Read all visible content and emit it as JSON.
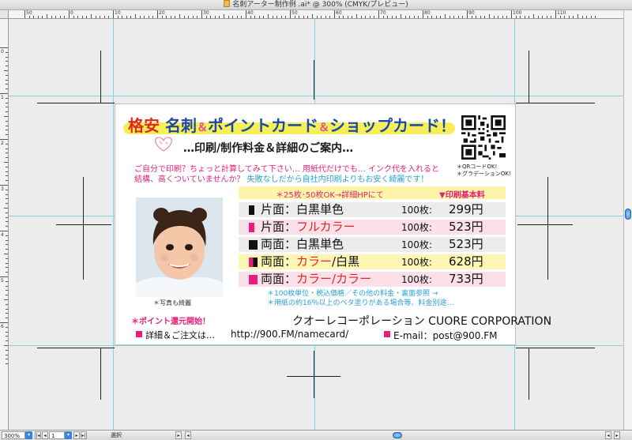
{
  "window": {
    "title": "名刺アーター制作例 .ai* @ 300% (CMYK/プレビュー)"
  },
  "rulers": {
    "horizontal_labels": [
      "50",
      "0",
      "10",
      "20",
      "30",
      "40",
      "50",
      "60",
      "70",
      "80",
      "90",
      "100",
      "110"
    ],
    "vertical_labels": [
      "0",
      "1",
      "2",
      "3",
      "4",
      "5",
      "6"
    ]
  },
  "status_bar": {
    "zoom": "300%",
    "page": "1",
    "tool": "選択"
  },
  "card": {
    "headline": {
      "part1": "格安",
      "part2": "名刺",
      "amp1": "＆",
      "part3": "ポイントカード",
      "amp2": "＆",
      "part4": "ショップカード！"
    },
    "subtitle": "…印刷/制作料金＆詳細のご案内…",
    "intro_line1": "ご自分で印刷？ちょっと計算してみて下さい… 用紙代だけでも… インク代を入れると",
    "intro_line2_pink": "結構、高くついていませんか？",
    "intro_line2_blue": "失敗なしだから自社内印刷よりもお安く綺麗です！",
    "qr_note1": "＊QRコードOK!",
    "qr_note2": "＊グラデーションOK!",
    "photo_caption": "＊写真も綺麗",
    "point_text": "＊ポイント還元開始！",
    "promo_left": "＊25枚･50枚OK→詳細HPにて",
    "promo_right": "▼印刷基本料",
    "price_rows": [
      {
        "side": "片面：",
        "print_a": "白黒単色",
        "print_b": "",
        "qty": "100枚:",
        "price": "299円"
      },
      {
        "side": "片面：",
        "print_a": "フルカラー",
        "print_b": "",
        "qty": "100枚:",
        "price": "523円"
      },
      {
        "side": "両面：",
        "print_a": "白黒単色",
        "print_b": "",
        "qty": "100枚:",
        "price": "523円"
      },
      {
        "side": "両面：",
        "print_a": "カラー",
        "print_b": "/白黒",
        "qty": "100枚:",
        "price": "628円"
      },
      {
        "side": "両面：",
        "print_a": "カラー/カラー",
        "print_b": "",
        "qty": "100枚:",
        "price": "733円"
      }
    ],
    "note1": "＊100枚単位・税込価格／その他の料金・裏面参照 →",
    "note2": "＊用紙の約16％以上のベタ塗りがある場合等、料金別途…",
    "company": "クオーレコーポレーション CUORE CORPORATION",
    "footer_detail": "詳細＆ご注文は…",
    "footer_url": "http://900.FM/namecard/",
    "footer_email": "E-mail：post@900.FM"
  },
  "colors": {
    "accent_pink": "#e5207a",
    "accent_red": "#e5261c",
    "accent_blue": "#1e47a8",
    "info_blue": "#2aa0d6",
    "guide_cyan": "#7fd6e2",
    "highlight_yellow": "#f5ef58"
  }
}
